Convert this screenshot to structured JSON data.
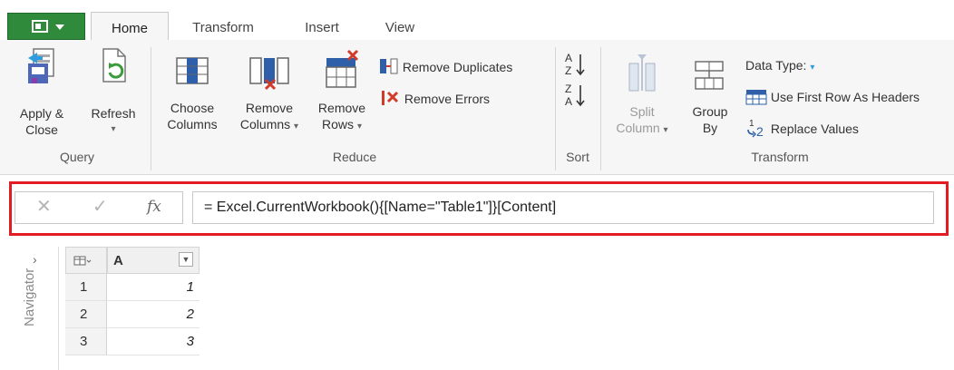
{
  "tabs": {
    "home": "Home",
    "transform": "Transform",
    "insert": "Insert",
    "view": "View"
  },
  "ribbon": {
    "query": {
      "label": "Query",
      "apply_close_1": "Apply &",
      "apply_close_2": "Close",
      "refresh": "Refresh"
    },
    "reduce": {
      "label": "Reduce",
      "choose_columns_1": "Choose",
      "choose_columns_2": "Columns",
      "remove_columns_1": "Remove",
      "remove_columns_2": "Columns",
      "remove_rows_1": "Remove",
      "remove_rows_2": "Rows",
      "remove_duplicates": "Remove Duplicates",
      "remove_errors": "Remove Errors"
    },
    "sort": {
      "label": "Sort"
    },
    "transform": {
      "label": "Transform",
      "split_column_1": "Split",
      "split_column_2": "Column",
      "group_by_1": "Group",
      "group_by_2": "By",
      "data_type": "Data Type:",
      "use_first_row": "Use First Row As Headers",
      "replace_values": "Replace Values"
    }
  },
  "formula_bar": {
    "cancel_glyph": "✕",
    "confirm_glyph": "✓",
    "fx_glyph": "fx",
    "formula": "= Excel.CurrentWorkbook(){[Name=\"Table1\"]}[Content]"
  },
  "navigator": {
    "label": "Navigator",
    "chevron": "›"
  },
  "grid": {
    "column_header": "A",
    "rows": [
      {
        "num": "1",
        "value": "1"
      },
      {
        "num": "2",
        "value": "2"
      },
      {
        "num": "3",
        "value": "3"
      }
    ]
  },
  "colors": {
    "accent_green": "#2f8a3b",
    "highlight_red": "#e31b23",
    "icon_blue": "#2e5fa8",
    "icon_red": "#d23a2a"
  }
}
